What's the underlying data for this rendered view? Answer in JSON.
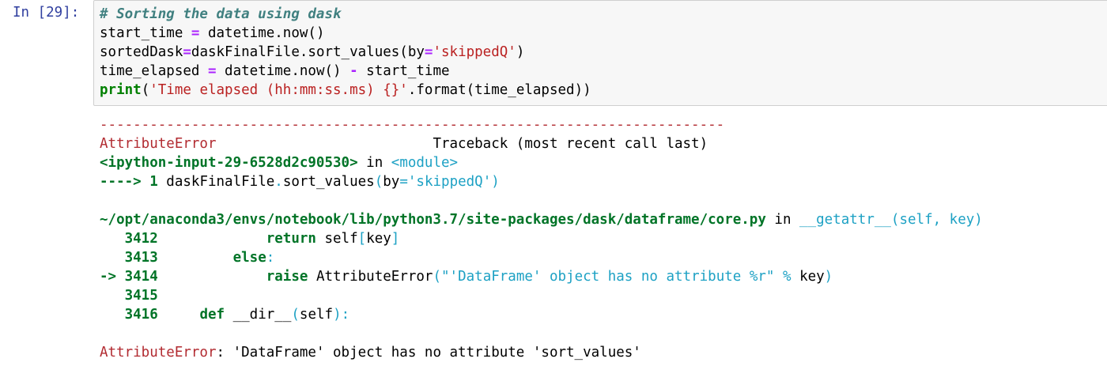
{
  "prompt": "In [29]:",
  "code": {
    "l1": "# Sorting the data using dask",
    "l2a": "start_time ",
    "l2b": "=",
    "l2c": " datetime.now()",
    "l3a": "sortedDask",
    "l3b": "=",
    "l3c": "daskFinalFile.sort_values(by",
    "l3d": "=",
    "l3e": "'skippedQ'",
    "l3f": ")",
    "l4a": "time_elapsed ",
    "l4b": "=",
    "l4c": " datetime.now() ",
    "l4d": "-",
    "l4e": " start_time",
    "l5a": "print",
    "l5b": "(",
    "l5c": "'Time elapsed (hh:mm:ss.ms) {}'",
    "l5d": ".format(time_elapsed))"
  },
  "traceback": {
    "dashes": "---------------------------------------------------------------------------",
    "err_name": "AttributeError",
    "tb_header": "                          Traceback (most recent call last)",
    "ipy_input": "<ipython-input-29-6528d2c90530>",
    "in": " in ",
    "module": "<module>",
    "arrow1": "----> 1 ",
    "arrow1_code_a": "daskFinalFile",
    "arrow1_code_b": ".",
    "arrow1_code_c": "sort_values",
    "arrow1_code_d": "(",
    "arrow1_code_e": "by",
    "arrow1_code_f": "=",
    "arrow1_code_g": "'skippedQ'",
    "arrow1_code_h": ")",
    "path": "~/opt/anaconda3/envs/notebook/lib/python3.7/site-packages/dask/dataframe/core.py",
    "in2": " in ",
    "func": "__getattr__(self, key)",
    "l3412_num": "   3412",
    "l3412_a": "             ",
    "l3412_b": "return",
    "l3412_c": " self",
    "l3412_d": "[",
    "l3412_e": "key",
    "l3412_f": "]",
    "l3413_num": "   3413",
    "l3413_a": "         ",
    "l3413_b": "else",
    "l3413_c": ":",
    "l3414_num": "-> 3414",
    "l3414_a": "             ",
    "l3414_b": "raise",
    "l3414_c": " AttributeError",
    "l3414_d": "(",
    "l3414_e": "\"'DataFrame' object has no attribute %r\"",
    "l3414_f": " % ",
    "l3414_g": "key",
    "l3414_h": ")",
    "l3415_num": "   3415",
    "l3416_num": "   3416",
    "l3416_a": "     ",
    "l3416_b": "def",
    "l3416_c": " __dir__",
    "l3416_d": "(",
    "l3416_e": "self",
    "l3416_f": "):",
    "final_name": "AttributeError",
    "final_msg": ": 'DataFrame' object has no attribute 'sort_values'"
  }
}
